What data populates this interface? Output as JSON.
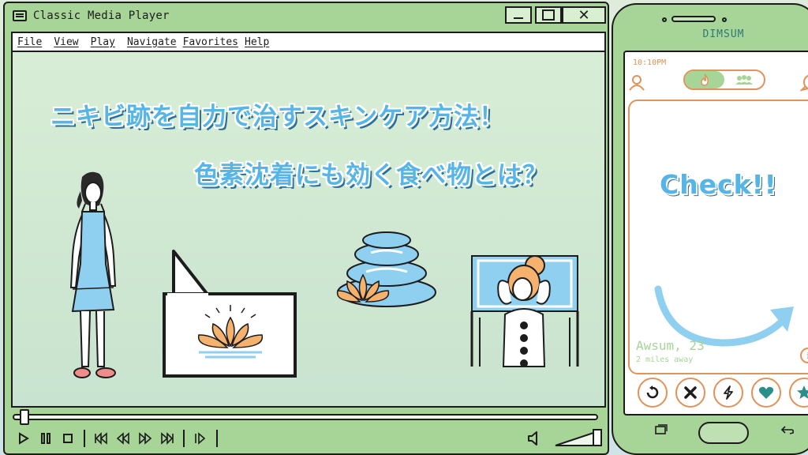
{
  "window": {
    "title": "Classic Media Player",
    "close_glyph": "✕"
  },
  "menu": {
    "items": [
      {
        "label": "File",
        "name": "menu-file"
      },
      {
        "label": "View",
        "name": "menu-view"
      },
      {
        "label": "Play",
        "name": "menu-play"
      },
      {
        "label": "Navigate",
        "name": "menu-navigate"
      },
      {
        "label": "Favorites",
        "name": "menu-favorites"
      },
      {
        "label": "Help",
        "name": "menu-help"
      }
    ]
  },
  "video": {
    "headline_1": "ニキビ跡を自力で治すスキンケア方法！",
    "headline_2": "色素沈着にも効く食べ物とは？",
    "progress": 0.01,
    "volume": 1.0
  },
  "controls": {
    "icons": [
      "play-icon",
      "pause-icon",
      "stop-icon",
      "skip-back-icon",
      "rewind-icon",
      "fast-forward-icon",
      "skip-forward-icon",
      "frame-step-icon"
    ]
  },
  "phone": {
    "brand": "DIMSUM",
    "time": "10:10PM",
    "card": {
      "headline": "Check!!",
      "name": "Awsum, 23",
      "distance": "2 miles away",
      "info_glyph": "i"
    },
    "actions": [
      "rewind-action",
      "dislike-action",
      "boost-action",
      "like-action",
      "superlike-action"
    ]
  },
  "colors": {
    "frame_green": "#a7d598",
    "accent_blue": "#56b4e6",
    "accent_orange": "#e0935a",
    "outline": "#1c1c1c"
  }
}
